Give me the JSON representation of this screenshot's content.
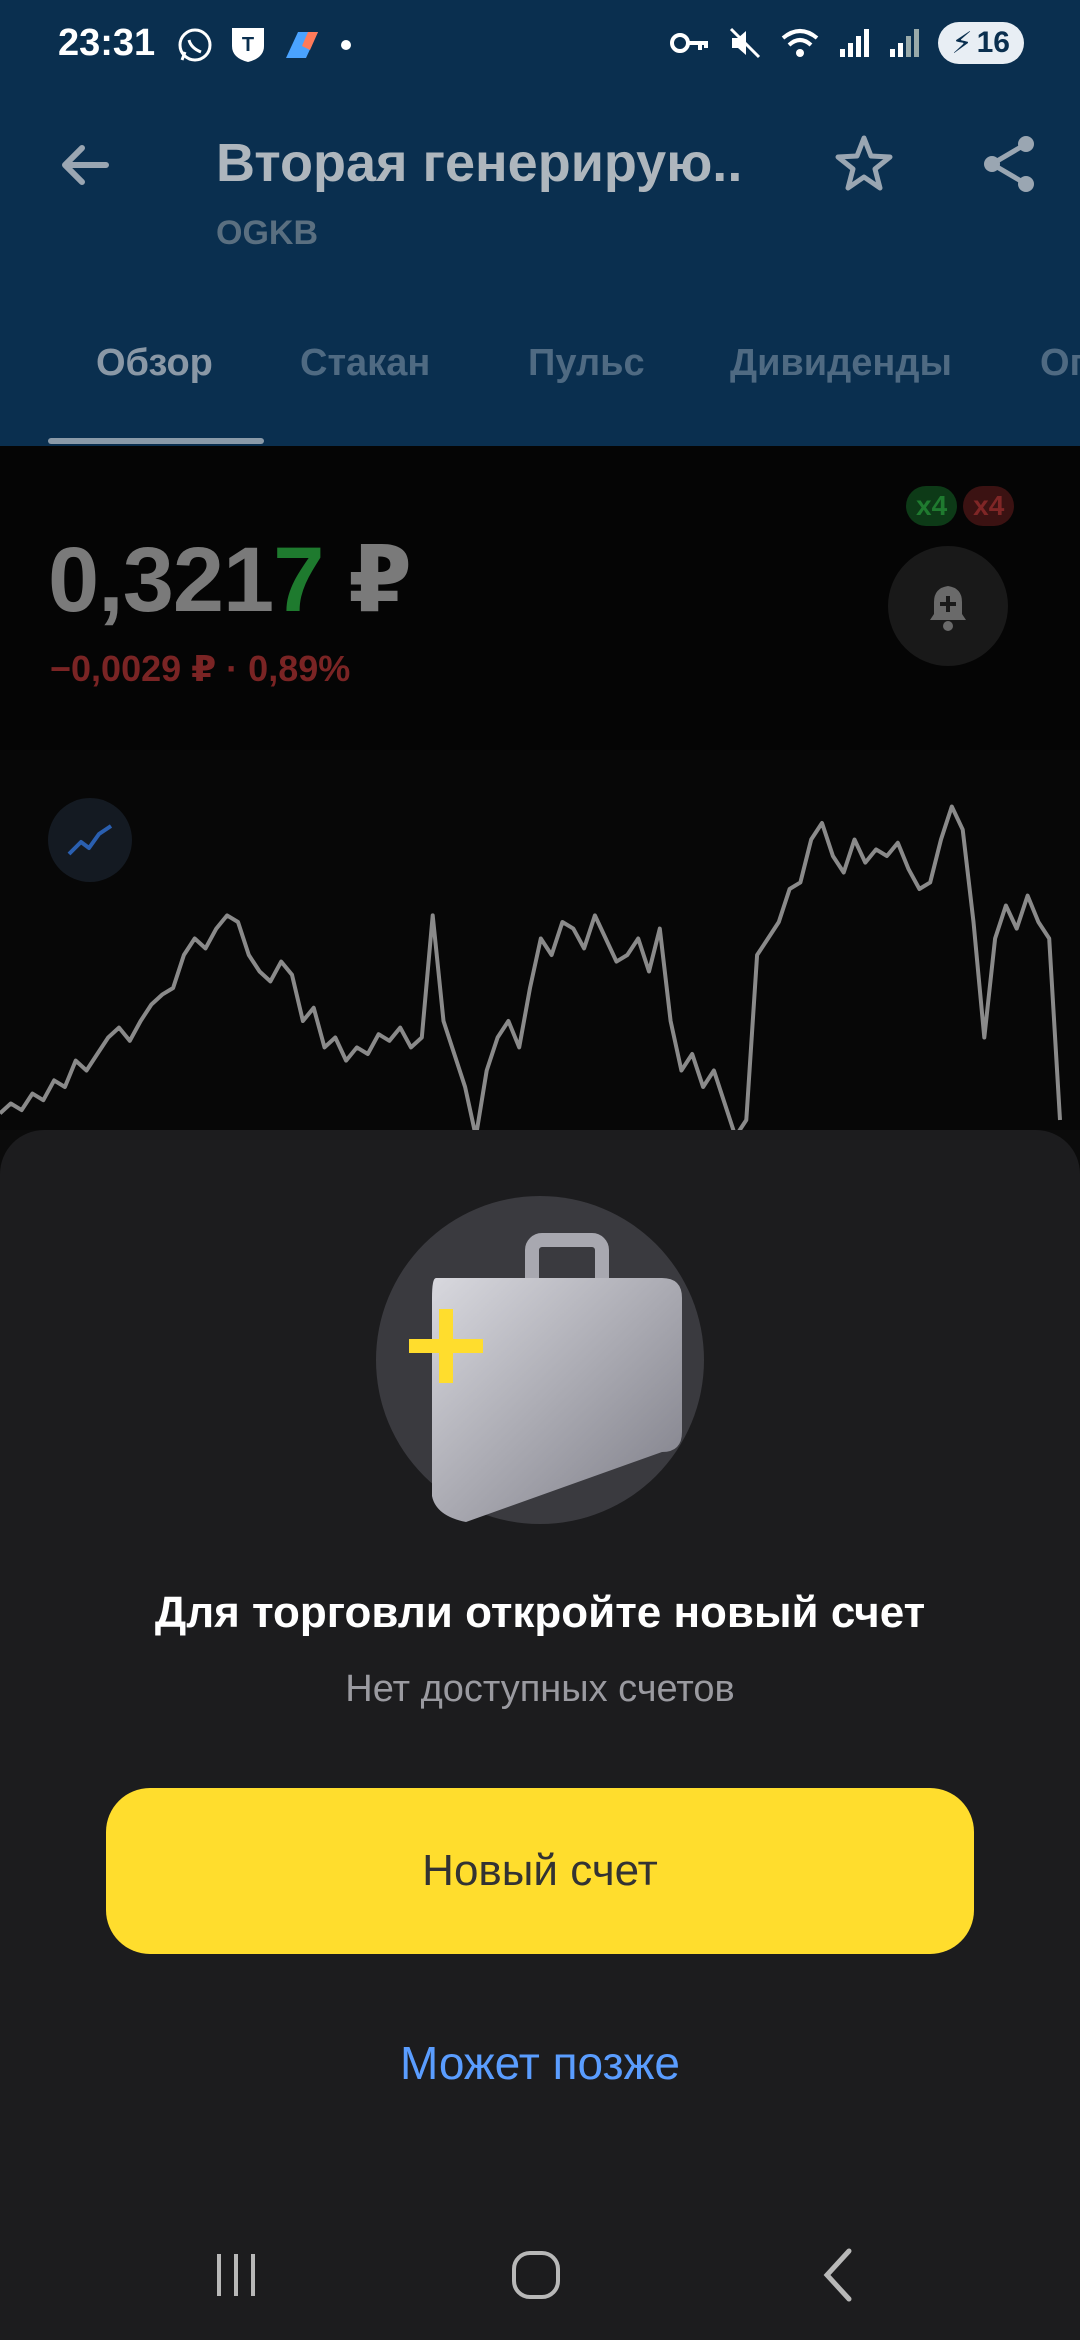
{
  "status_bar": {
    "time": "23:31",
    "battery": "16",
    "left_icons": [
      "whatsapp-icon",
      "tinkoff-icon",
      "app-icon",
      "dot-icon"
    ],
    "right_icons": [
      "vpn-key-icon",
      "mute-icon",
      "wifi-icon",
      "signal-icon",
      "signal-icon",
      "battery-icon"
    ]
  },
  "header": {
    "title": "Вторая генерирую..",
    "ticker": "OGKB",
    "tabs": [
      {
        "label": "Обзор",
        "active": true
      },
      {
        "label": "Стакан",
        "active": false
      },
      {
        "label": "Пульс",
        "active": false
      },
      {
        "label": "Дивиденды",
        "active": false
      },
      {
        "label": "Оп",
        "active": false
      }
    ]
  },
  "quote": {
    "price_main": "0,321",
    "price_last_digit": "7",
    "currency": "₽",
    "change": "−0,0029 ₽ · 0,89%",
    "badge_buy": "x4",
    "badge_sell": "x4"
  },
  "chart_data": {
    "type": "line",
    "y": [
      0.02,
      0.05,
      0.03,
      0.08,
      0.06,
      0.12,
      0.1,
      0.18,
      0.15,
      0.2,
      0.25,
      0.28,
      0.24,
      0.3,
      0.35,
      0.38,
      0.4,
      0.5,
      0.55,
      0.52,
      0.58,
      0.62,
      0.6,
      0.5,
      0.45,
      0.42,
      0.48,
      0.44,
      0.3,
      0.34,
      0.22,
      0.25,
      0.18,
      0.22,
      0.2,
      0.26,
      0.24,
      0.28,
      0.22,
      0.25,
      0.62,
      0.3,
      0.2,
      0.1,
      -0.05,
      0.15,
      0.25,
      0.3,
      0.22,
      0.4,
      0.55,
      0.5,
      0.6,
      0.58,
      0.52,
      0.62,
      0.55,
      0.48,
      0.5,
      0.55,
      0.45,
      0.58,
      0.3,
      0.15,
      0.2,
      0.1,
      0.15,
      0.05,
      -0.05,
      0.0,
      0.5,
      0.55,
      0.6,
      0.7,
      0.72,
      0.85,
      0.9,
      0.8,
      0.75,
      0.85,
      0.78,
      0.82,
      0.8,
      0.84,
      0.76,
      0.7,
      0.72,
      0.85,
      0.95,
      0.88,
      0.6,
      0.25,
      0.55,
      0.65,
      0.58,
      0.68,
      0.6,
      0.55,
      0.0
    ]
  },
  "sheet": {
    "title": "Для торговли откройте новый счет",
    "subtitle": "Нет доступных счетов",
    "primary_button": "Новый счет",
    "secondary_link": "Может позже"
  },
  "colors": {
    "accent_yellow": "#ffdd2d",
    "link_blue": "#5a9dff",
    "header_bg": "#0a2f4f",
    "sheet_bg": "#1c1c1e"
  }
}
